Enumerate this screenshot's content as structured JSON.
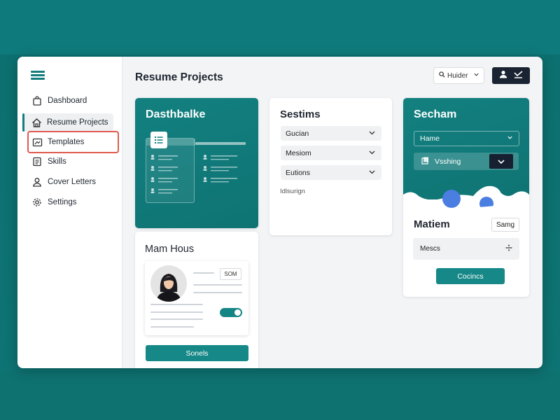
{
  "header": {
    "title": "Resume Projects",
    "search_label": "Huider"
  },
  "sidebar": {
    "items": [
      {
        "label": "Dashboard",
        "icon": "bag-icon"
      },
      {
        "label": "Resume Projects",
        "icon": "home-icon",
        "active": true
      },
      {
        "label": "Templates",
        "icon": "templates-icon",
        "highlighted": true
      },
      {
        "label": "Skills",
        "icon": "list-icon"
      },
      {
        "label": "Cover Letters",
        "icon": "person-icon"
      },
      {
        "label": "Settings",
        "icon": "gear-icon"
      }
    ]
  },
  "cards": {
    "dashboard": {
      "title": "Dasthbalke"
    },
    "sestims": {
      "title": "Sestims",
      "dropdowns": [
        "Gucian",
        "Mesiom",
        "Eutions"
      ],
      "footer": "Idlsurign"
    },
    "secham": {
      "title": "Secham",
      "select_value": "Hame",
      "item_label": "Vsshing"
    },
    "matiem": {
      "title": "Matiem",
      "badge": "Samg",
      "row_label": "Mescs",
      "button_label": "Cocincs"
    },
    "mamhous": {
      "title": "Mam Hous",
      "badge": "SOM",
      "toggle_on": true,
      "button_label": "Sonels"
    }
  },
  "colors": {
    "accent": "#137d7d",
    "highlight_outline": "#e05a4f",
    "dark": "#1a2332"
  }
}
